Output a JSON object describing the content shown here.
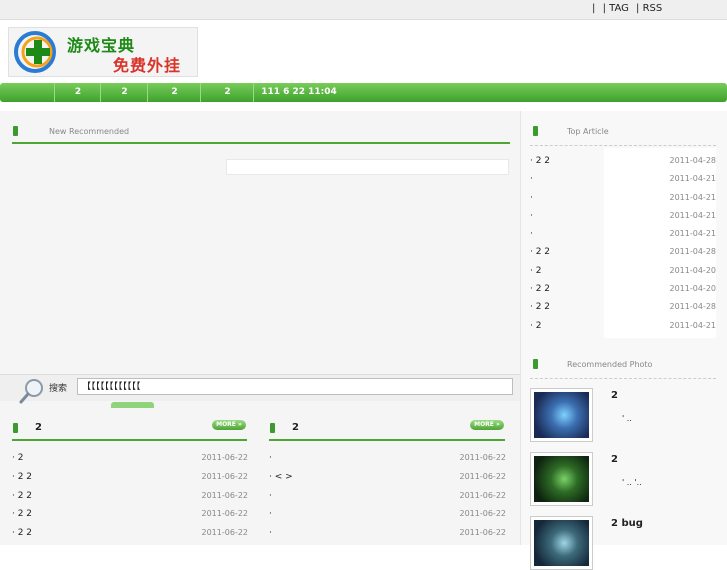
{
  "header": {
    "top_links": [
      "|",
      "| TAG",
      "| RSS"
    ],
    "logo_line1": "游戏宝典",
    "logo_line2": "免费外挂"
  },
  "nav": {
    "items": [
      "2",
      "2",
      "2",
      "2",
      "111  6  22   11:04"
    ]
  },
  "new_recommended": {
    "title": "New Recommended"
  },
  "search": {
    "label": "搜索",
    "value": "【【【【【【【【【【【【"
  },
  "left_col": {
    "head": "2",
    "more": "MORE »",
    "rows": [
      {
        "text": "· 2",
        "date": "2011-06-22"
      },
      {
        "text": "· 2    2",
        "date": "2011-06-22"
      },
      {
        "text": "· 2      2",
        "date": "2011-06-22"
      },
      {
        "text": "· 2      2",
        "date": "2011-06-22"
      },
      {
        "text": "· 2      2",
        "date": "2011-06-22"
      }
    ]
  },
  "right_col": {
    "head": "2",
    "more": "MORE »",
    "rows": [
      {
        "text": "·",
        "date": "2011-06-22"
      },
      {
        "text": "·              <    >",
        "date": "2011-06-22"
      },
      {
        "text": "·",
        "date": "2011-06-22"
      },
      {
        "text": "·",
        "date": "2011-06-22"
      },
      {
        "text": "·",
        "date": "2011-06-22"
      }
    ]
  },
  "top_article": {
    "title": "Top Article",
    "rows": [
      {
        "text": "· 2      2",
        "date": "2011-04-28"
      },
      {
        "text": "·",
        "date": "2011-04-21"
      },
      {
        "text": "·",
        "date": "2011-04-21"
      },
      {
        "text": "·",
        "date": "2011-04-21"
      },
      {
        "text": "·",
        "date": "2011-04-21"
      },
      {
        "text": "· 2          2",
        "date": "2011-04-28"
      },
      {
        "text": "· 2",
        "date": "2011-04-20"
      },
      {
        "text": "· 2     2",
        "date": "2011-04-20"
      },
      {
        "text": "· 2          2",
        "date": "2011-04-28"
      },
      {
        "text": "· 2",
        "date": "2011-04-21"
      }
    ]
  },
  "recommended_photo": {
    "title": "Recommended Photo",
    "items": [
      {
        "title": "2",
        "sub": "' ..",
        "colors": [
          "#1a2a55",
          "#3b6fb0",
          "#7fd0ff"
        ]
      },
      {
        "title": "2",
        "sub": "' .. '..",
        "colors": [
          "#0f2410",
          "#2d6b25",
          "#7ad16a"
        ]
      },
      {
        "title": "2    bug",
        "sub": "",
        "colors": [
          "#14283a",
          "#3d6a7a",
          "#9fd6e6"
        ]
      }
    ]
  },
  "colors": {
    "brand_green": "#4da534",
    "nav_green": "#3ea12c"
  }
}
